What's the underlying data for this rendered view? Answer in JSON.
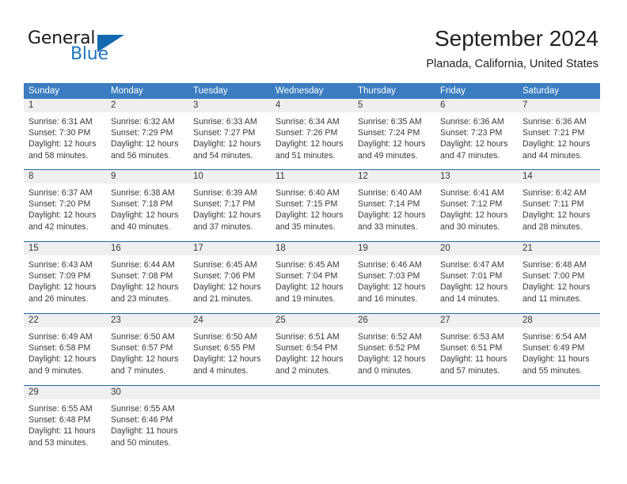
{
  "brand": {
    "name_part1": "General",
    "name_part2": "Blue",
    "logo_icon": "blue-triangle-icon"
  },
  "header": {
    "title": "September 2024",
    "subtitle": "Planada, California, United States"
  },
  "calendar": {
    "weekdays": [
      "Sunday",
      "Monday",
      "Tuesday",
      "Wednesday",
      "Thursday",
      "Friday",
      "Saturday"
    ],
    "header_bg": "#3b7dc0",
    "header_text": "#ffffff",
    "row_divider": "#2a6aa8",
    "day_band_bg": "#efefef",
    "weeks": [
      [
        {
          "day": "1",
          "sunrise": "Sunrise: 6:31 AM",
          "sunset": "Sunset: 7:30 PM",
          "daylight1": "Daylight: 12 hours",
          "daylight2": "and 58 minutes."
        },
        {
          "day": "2",
          "sunrise": "Sunrise: 6:32 AM",
          "sunset": "Sunset: 7:29 PM",
          "daylight1": "Daylight: 12 hours",
          "daylight2": "and 56 minutes."
        },
        {
          "day": "3",
          "sunrise": "Sunrise: 6:33 AM",
          "sunset": "Sunset: 7:27 PM",
          "daylight1": "Daylight: 12 hours",
          "daylight2": "and 54 minutes."
        },
        {
          "day": "4",
          "sunrise": "Sunrise: 6:34 AM",
          "sunset": "Sunset: 7:26 PM",
          "daylight1": "Daylight: 12 hours",
          "daylight2": "and 51 minutes."
        },
        {
          "day": "5",
          "sunrise": "Sunrise: 6:35 AM",
          "sunset": "Sunset: 7:24 PM",
          "daylight1": "Daylight: 12 hours",
          "daylight2": "and 49 minutes."
        },
        {
          "day": "6",
          "sunrise": "Sunrise: 6:36 AM",
          "sunset": "Sunset: 7:23 PM",
          "daylight1": "Daylight: 12 hours",
          "daylight2": "and 47 minutes."
        },
        {
          "day": "7",
          "sunrise": "Sunrise: 6:36 AM",
          "sunset": "Sunset: 7:21 PM",
          "daylight1": "Daylight: 12 hours",
          "daylight2": "and 44 minutes."
        }
      ],
      [
        {
          "day": "8",
          "sunrise": "Sunrise: 6:37 AM",
          "sunset": "Sunset: 7:20 PM",
          "daylight1": "Daylight: 12 hours",
          "daylight2": "and 42 minutes."
        },
        {
          "day": "9",
          "sunrise": "Sunrise: 6:38 AM",
          "sunset": "Sunset: 7:18 PM",
          "daylight1": "Daylight: 12 hours",
          "daylight2": "and 40 minutes."
        },
        {
          "day": "10",
          "sunrise": "Sunrise: 6:39 AM",
          "sunset": "Sunset: 7:17 PM",
          "daylight1": "Daylight: 12 hours",
          "daylight2": "and 37 minutes."
        },
        {
          "day": "11",
          "sunrise": "Sunrise: 6:40 AM",
          "sunset": "Sunset: 7:15 PM",
          "daylight1": "Daylight: 12 hours",
          "daylight2": "and 35 minutes."
        },
        {
          "day": "12",
          "sunrise": "Sunrise: 6:40 AM",
          "sunset": "Sunset: 7:14 PM",
          "daylight1": "Daylight: 12 hours",
          "daylight2": "and 33 minutes."
        },
        {
          "day": "13",
          "sunrise": "Sunrise: 6:41 AM",
          "sunset": "Sunset: 7:12 PM",
          "daylight1": "Daylight: 12 hours",
          "daylight2": "and 30 minutes."
        },
        {
          "day": "14",
          "sunrise": "Sunrise: 6:42 AM",
          "sunset": "Sunset: 7:11 PM",
          "daylight1": "Daylight: 12 hours",
          "daylight2": "and 28 minutes."
        }
      ],
      [
        {
          "day": "15",
          "sunrise": "Sunrise: 6:43 AM",
          "sunset": "Sunset: 7:09 PM",
          "daylight1": "Daylight: 12 hours",
          "daylight2": "and 26 minutes."
        },
        {
          "day": "16",
          "sunrise": "Sunrise: 6:44 AM",
          "sunset": "Sunset: 7:08 PM",
          "daylight1": "Daylight: 12 hours",
          "daylight2": "and 23 minutes."
        },
        {
          "day": "17",
          "sunrise": "Sunrise: 6:45 AM",
          "sunset": "Sunset: 7:06 PM",
          "daylight1": "Daylight: 12 hours",
          "daylight2": "and 21 minutes."
        },
        {
          "day": "18",
          "sunrise": "Sunrise: 6:45 AM",
          "sunset": "Sunset: 7:04 PM",
          "daylight1": "Daylight: 12 hours",
          "daylight2": "and 19 minutes."
        },
        {
          "day": "19",
          "sunrise": "Sunrise: 6:46 AM",
          "sunset": "Sunset: 7:03 PM",
          "daylight1": "Daylight: 12 hours",
          "daylight2": "and 16 minutes."
        },
        {
          "day": "20",
          "sunrise": "Sunrise: 6:47 AM",
          "sunset": "Sunset: 7:01 PM",
          "daylight1": "Daylight: 12 hours",
          "daylight2": "and 14 minutes."
        },
        {
          "day": "21",
          "sunrise": "Sunrise: 6:48 AM",
          "sunset": "Sunset: 7:00 PM",
          "daylight1": "Daylight: 12 hours",
          "daylight2": "and 11 minutes."
        }
      ],
      [
        {
          "day": "22",
          "sunrise": "Sunrise: 6:49 AM",
          "sunset": "Sunset: 6:58 PM",
          "daylight1": "Daylight: 12 hours",
          "daylight2": "and 9 minutes."
        },
        {
          "day": "23",
          "sunrise": "Sunrise: 6:50 AM",
          "sunset": "Sunset: 6:57 PM",
          "daylight1": "Daylight: 12 hours",
          "daylight2": "and 7 minutes."
        },
        {
          "day": "24",
          "sunrise": "Sunrise: 6:50 AM",
          "sunset": "Sunset: 6:55 PM",
          "daylight1": "Daylight: 12 hours",
          "daylight2": "and 4 minutes."
        },
        {
          "day": "25",
          "sunrise": "Sunrise: 6:51 AM",
          "sunset": "Sunset: 6:54 PM",
          "daylight1": "Daylight: 12 hours",
          "daylight2": "and 2 minutes."
        },
        {
          "day": "26",
          "sunrise": "Sunrise: 6:52 AM",
          "sunset": "Sunset: 6:52 PM",
          "daylight1": "Daylight: 12 hours",
          "daylight2": "and 0 minutes."
        },
        {
          "day": "27",
          "sunrise": "Sunrise: 6:53 AM",
          "sunset": "Sunset: 6:51 PM",
          "daylight1": "Daylight: 11 hours",
          "daylight2": "and 57 minutes."
        },
        {
          "day": "28",
          "sunrise": "Sunrise: 6:54 AM",
          "sunset": "Sunset: 6:49 PM",
          "daylight1": "Daylight: 11 hours",
          "daylight2": "and 55 minutes."
        }
      ],
      [
        {
          "day": "29",
          "sunrise": "Sunrise: 6:55 AM",
          "sunset": "Sunset: 6:48 PM",
          "daylight1": "Daylight: 11 hours",
          "daylight2": "and 53 minutes."
        },
        {
          "day": "30",
          "sunrise": "Sunrise: 6:55 AM",
          "sunset": "Sunset: 6:46 PM",
          "daylight1": "Daylight: 11 hours",
          "daylight2": "and 50 minutes."
        },
        {
          "day": "",
          "sunrise": "",
          "sunset": "",
          "daylight1": "",
          "daylight2": ""
        },
        {
          "day": "",
          "sunrise": "",
          "sunset": "",
          "daylight1": "",
          "daylight2": ""
        },
        {
          "day": "",
          "sunrise": "",
          "sunset": "",
          "daylight1": "",
          "daylight2": ""
        },
        {
          "day": "",
          "sunrise": "",
          "sunset": "",
          "daylight1": "",
          "daylight2": ""
        },
        {
          "day": "",
          "sunrise": "",
          "sunset": "",
          "daylight1": "",
          "daylight2": ""
        }
      ]
    ]
  }
}
